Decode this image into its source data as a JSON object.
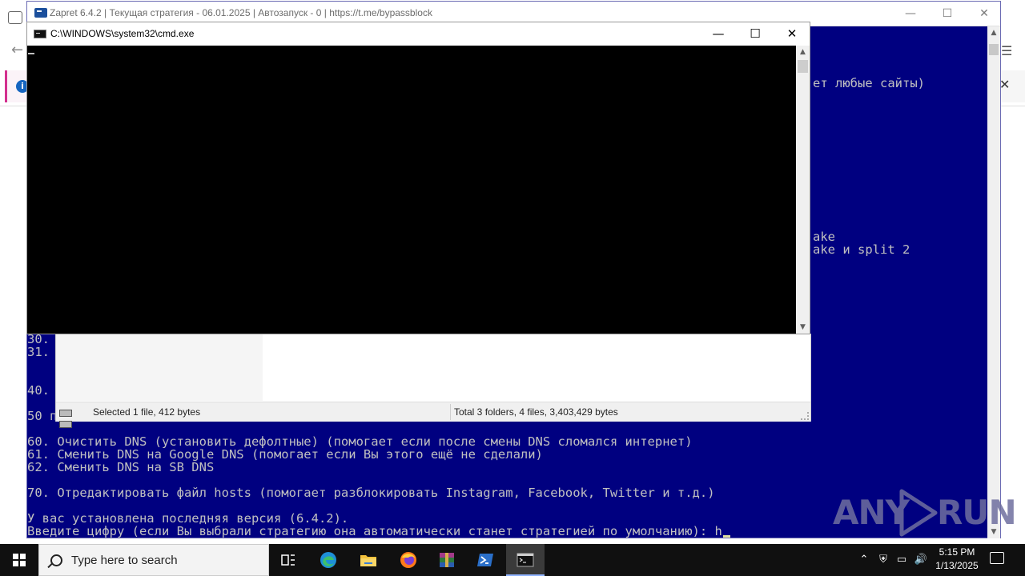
{
  "zapret": {
    "title": "Zapret 6.4.2 | Текущая стратегия - 06.01.2025 | Автозапуск - 0 | https://t.me/bypassblock",
    "right_fragments": [
      "ет любые сайты)",
      "ake",
      "ake и split 2"
    ],
    "left_fragments": [
      "30.",
      "31.",
      "40.",
      "50 п"
    ],
    "lines": [
      "60. Очистить DNS (установить дефолтные) (помогает если после смены DNS сломался интернет)",
      "61. Сменить DNS на Google DNS (помогает если Вы этого ещё не сделали)",
      "62. Сменить DNS на SB DNS",
      "",
      "70. Отредактировать файл hosts (помогает разблокировать Instagram, Facebook, Twitter и т.д.)",
      "",
      "У вас установлена последняя версия (6.4.2).",
      "Введите цифру (если Вы выбрали стратегию она автоматически станет стратегией по умолчанию): h"
    ]
  },
  "explorer": {
    "status_left": "Selected 1 file, 412 bytes",
    "status_right": "Total 3 folders, 4 files, 3,403,429 bytes"
  },
  "cmd": {
    "title": "C:\\WINDOWS\\system32\\cmd.exe"
  },
  "watermark": {
    "text_left": "ANY",
    "text_right": "RUN"
  },
  "taskbar": {
    "search_placeholder": "Type here to search",
    "time": "5:15 PM",
    "date": "1/13/2025",
    "pinned": [
      "task-view",
      "edge",
      "file-explorer",
      "firefox",
      "winrar",
      "powershell",
      "cmd"
    ]
  }
}
